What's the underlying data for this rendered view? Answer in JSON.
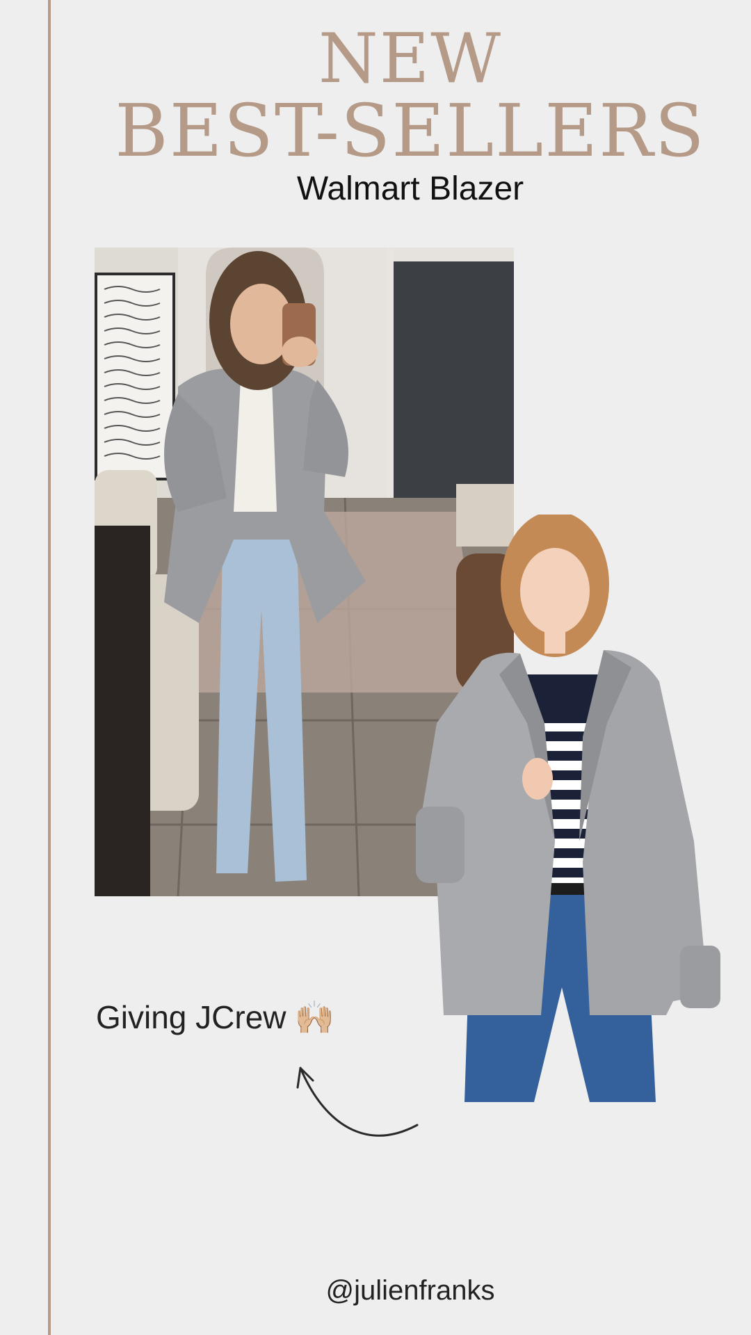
{
  "headline": {
    "line1": "NEW",
    "line2": "BEST-SELLERS"
  },
  "subtitle": "Walmart Blazer",
  "caption": {
    "text": "Giving JCrew",
    "emoji": "🙌🏼"
  },
  "handle": "@julienfranks",
  "colors": {
    "background": "#eeeeee",
    "accent": "#b59a88",
    "text": "#111111"
  },
  "images": {
    "main_photo": "woman-mirror-selfie-grey-blazer",
    "product_photo": "model-grey-blazer-striped-top"
  }
}
